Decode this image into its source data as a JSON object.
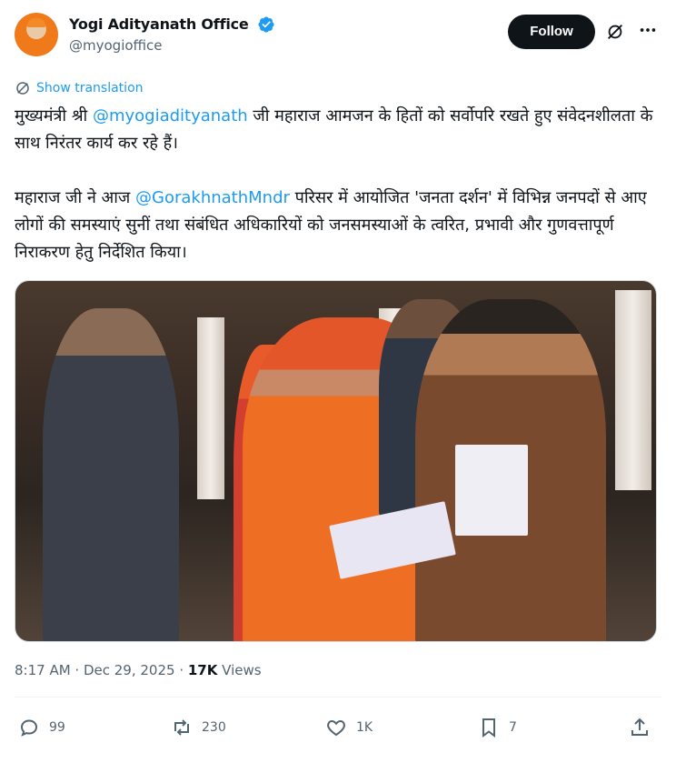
{
  "author": {
    "display_name": "Yogi Adityanath Office",
    "handle": "@myogioffice",
    "verified_icon": "verified-badge-icon"
  },
  "header": {
    "follow_label": "Follow"
  },
  "translation": {
    "label": "Show translation"
  },
  "post": {
    "p1_prefix": "मुख्यमंत्री श्री ",
    "p1_mention": "@myogiadityanath",
    "p1_suffix": " जी महाराज आमजन के हितों को सर्वोपरि रखते हुए संवेदनशीलता के साथ निरंतर कार्य कर रहे हैं।",
    "p2_prefix": "महाराज जी ने आज ",
    "p2_mention": "@GorakhnathMndr",
    "p2_suffix": " परिसर में आयोजित 'जनता दर्शन' में विभिन्न जनपदों से आए लोगों की समस्याएं सुनीं तथा संबंधित अधिकारियों को जनसमस्याओं के त्वरित, प्रभावी और गुणवत्तापूर्ण निराकरण हेतु निर्देशित किया।"
  },
  "meta": {
    "time": "8:17 AM",
    "separator": " · ",
    "date": "Dec 29, 2025",
    "views_count": "17K",
    "views_label": " Views"
  },
  "actions": {
    "replies": "99",
    "reposts": "230",
    "likes": "1K",
    "bookmarks": "7"
  },
  "colors": {
    "accent": "#1d9bf0",
    "text": "#0f1419",
    "muted": "#536471",
    "follow_bg": "#0f1419"
  }
}
